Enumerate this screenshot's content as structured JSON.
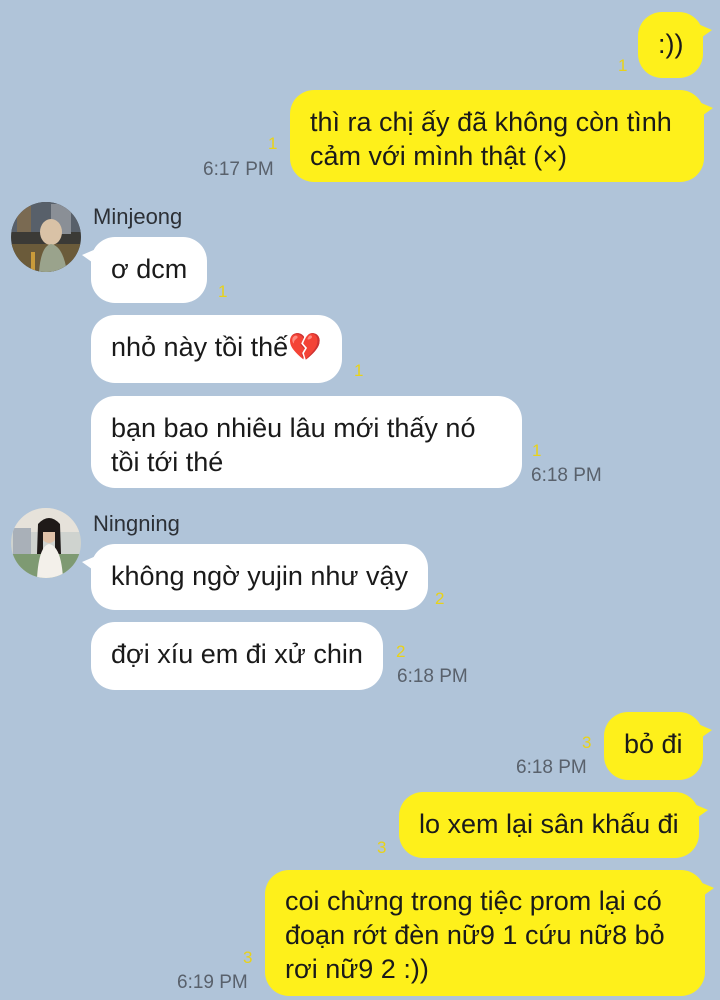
{
  "colors": {
    "background": "#b0c4d9",
    "outgoing_bubble": "#fef01b",
    "incoming_bubble": "#ffffff",
    "read_count": "#e8d21a"
  },
  "messages": [
    {
      "direction": "out",
      "text": ":))",
      "count": "1"
    },
    {
      "direction": "out",
      "lines": [
        "thì ra chị ấy đã không còn tình",
        "cảm với mình thật (×)"
      ],
      "count": "1",
      "time": "6:17 PM"
    },
    {
      "direction": "in",
      "sender": "Minjeong",
      "avatar_icon": "avatar-minjeong",
      "text": "ơ dcm",
      "count": "1"
    },
    {
      "direction": "in",
      "text": "nhỏ này tồi thế",
      "emoji": "💔",
      "emoji_icon": "broken-heart-icon",
      "count": "1"
    },
    {
      "direction": "in",
      "lines": [
        "bạn bao nhiêu lâu mới thấy nó",
        "tồi tới thé"
      ],
      "count": "1",
      "time": "6:18 PM"
    },
    {
      "direction": "in",
      "sender": "Ningning",
      "avatar_icon": "avatar-ningning",
      "text": "không ngờ yujin như vậy",
      "count": "2"
    },
    {
      "direction": "in",
      "text": "đợi xíu em đi xử chin",
      "count": "2",
      "time": "6:18 PM"
    },
    {
      "direction": "out",
      "text": "bỏ đi",
      "count": "3",
      "time": "6:18 PM"
    },
    {
      "direction": "out",
      "text": "lo xem lại sân khấu đi",
      "count": "3"
    },
    {
      "direction": "out",
      "lines": [
        "coi chừng trong tiệc prom lại có",
        "đoạn rớt đèn nữ9 1 cứu nữ8 bỏ",
        "rơi nữ9 2 :))"
      ],
      "count": "3",
      "time": "6:19 PM"
    }
  ]
}
